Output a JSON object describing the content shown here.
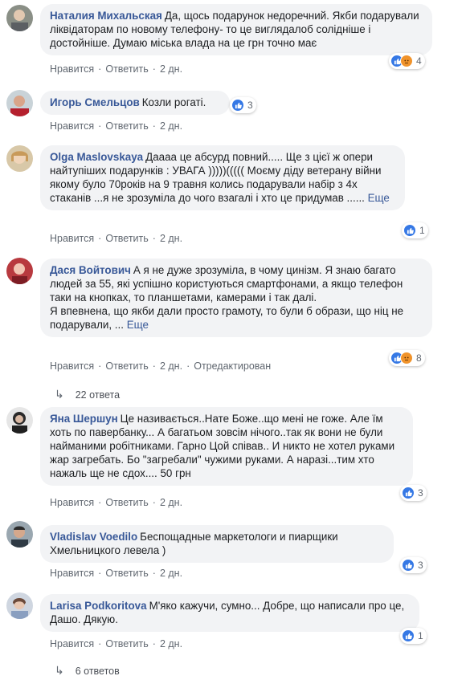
{
  "ui": {
    "like": "Нравится",
    "reply": "Ответить",
    "dot": "·",
    "edited": "Отредактирован"
  },
  "comments": [
    {
      "author": "Наталия Михальская",
      "text": "Да, щось подарунок недоречний. Якби подарували ліквідаторам по новому телефону- то це виглядалоб солідніше і достойніше. Думаю міська влада на це грн точно має",
      "time": "2 дн.",
      "reaction_icons": [
        "like-icon",
        "angry-icon"
      ],
      "reaction_count": "4"
    },
    {
      "author": "Игорь Смельцов",
      "text": "Козли рогаті.",
      "time": "2 дн.",
      "reaction_icons": [
        "like-icon"
      ],
      "reaction_count": "3"
    },
    {
      "author": "Olga Maslovskaya",
      "text": "Даааа це абсурд повний..... Ще з цієї ж опери найтупіших подарунків : УВАГА )))))((((( Моєму діду ветерану війни якому було 70років на 9 травня колись подарували набір з 4х стаканів ...я не зрозуміла до чого взагалі і хто це придумав ......",
      "more": "Еще",
      "time": "2 дн.",
      "reaction_icons": [
        "like-icon"
      ],
      "reaction_count": "1"
    },
    {
      "author": "Дася Войтович",
      "text": "А я не дуже зрозуміла, в чому цинізм. Я знаю багато людей за 55, які успішно користуються смартфонами, а якщо телефон таки на кнопках, то планшетами, камерами і так далі.",
      "text2": "Я впевнена, що якби дали просто грамоту, то були б образи, що ніц не подарували, ...",
      "more": "Еще",
      "time": "2 дн.",
      "edited": true,
      "reaction_icons": [
        "like-icon",
        "angry-icon"
      ],
      "reaction_count": "8",
      "replies": "22 ответа"
    },
    {
      "author": "Яна Шершун",
      "text": "Це називається..Нате Боже..що мені не гоже. Але їм хоть по павербанку... А багатьом зовсім нічого..так як вони не були найманими робітниками. Гарно Цой співав.. И никто не хотел руками жар загребать. Бо \"загребали\" чужими руками. А наразі...тим хто нажаль ще не сдох.... 50 грн",
      "time": "2 дн.",
      "reaction_icons": [
        "like-icon"
      ],
      "reaction_count": "3"
    },
    {
      "author": "Vladislav Voedilo",
      "text": "Беспощадные маркетологи и пиарщики Хмельницкого левела )",
      "time": "2 дн.",
      "reaction_icons": [
        "like-icon"
      ],
      "reaction_count": "3"
    },
    {
      "author": "Larisa Podkoritova",
      "text": "М'яко кажучи, сумно... Добре, що написали про це, Дашо. Дякую.",
      "time": "2 дн.",
      "reaction_icons": [
        "like-icon"
      ],
      "reaction_count": "1",
      "replies": "6 ответов"
    }
  ],
  "colors": {
    "link": "#385898",
    "bubble": "#f2f3f5",
    "meta": "#606770",
    "like": "#3578e5",
    "angry": "#f0932b"
  }
}
